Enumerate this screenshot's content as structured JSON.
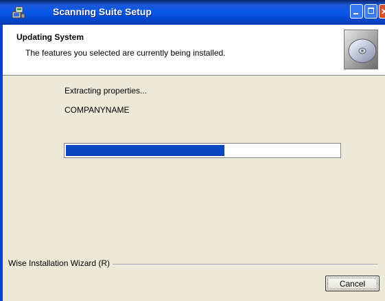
{
  "window": {
    "title": "Scanning Suite Setup",
    "icon": "setup-installer-icon"
  },
  "header": {
    "title": "Updating System",
    "subtitle": "The features you selected are currently being installed.",
    "icon": "cd-disc-icon"
  },
  "status": {
    "action": "Extracting properties...",
    "detail": "COMPANYNAME",
    "progress_fraction": 0.58
  },
  "footer": {
    "brand": "Wise Installation Wizard (R)"
  },
  "buttons": {
    "cancel": "Cancel"
  },
  "colors": {
    "titlebar": "#0858e8",
    "progress_fill": "#0a47bd",
    "dialog_bg": "#ece9d8"
  }
}
